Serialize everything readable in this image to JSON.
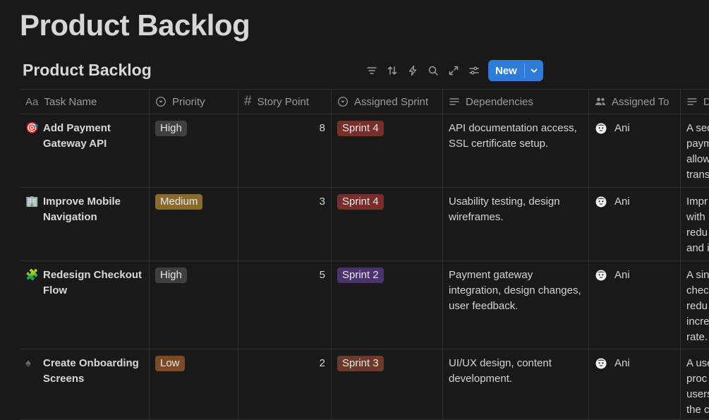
{
  "page": {
    "title": "Product Backlog"
  },
  "database": {
    "title": "Product Backlog"
  },
  "toolbar": {
    "icons": [
      "filter-icon",
      "sort-icon",
      "automation-icon",
      "search-icon",
      "expand-icon",
      "settings-icon"
    ],
    "new_label": "New",
    "accent": "#2f7bd8"
  },
  "columns": [
    {
      "label": "Task Name",
      "icon": "text-aa-icon",
      "glyph": "Aa"
    },
    {
      "label": "Priority",
      "icon": "select-icon"
    },
    {
      "label": "Story Point",
      "icon": "number-icon",
      "glyph": "#"
    },
    {
      "label": "Assigned Sprint",
      "icon": "select-icon"
    },
    {
      "label": "Dependencies",
      "icon": "text-lines-icon"
    },
    {
      "label": "Assigned To",
      "icon": "people-icon"
    },
    {
      "label": "D",
      "icon": "text-lines-icon"
    }
  ],
  "rows": [
    {
      "emoji": "🎯",
      "task": "Add Payment Gateway API",
      "priority": {
        "label": "High",
        "color": "#3f3f3f"
      },
      "points": "8",
      "sprint": {
        "label": "Sprint 4",
        "color": "#7a2e2a"
      },
      "dependencies": "API documentation access, SSL certificate setup.",
      "assignee": "Ani",
      "desc_lines": [
        "A sec",
        "paym",
        "allow",
        "trans"
      ]
    },
    {
      "emoji": "🏢",
      "task": "Improve Mobile Navigation",
      "priority": {
        "label": "Medium",
        "color": "#8a6b2d"
      },
      "points": "3",
      "sprint": {
        "label": "Sprint 4",
        "color": "#7a2e2a"
      },
      "dependencies": "Usability testing, design wireframes.",
      "assignee": "Ani",
      "desc_lines": [
        "Impr",
        "with",
        "redu",
        "and i"
      ]
    },
    {
      "emoji": "🧩",
      "task": "Redesign Checkout Flow",
      "priority": {
        "label": "High",
        "color": "#3f3f3f"
      },
      "points": "5",
      "sprint": {
        "label": "Sprint 2",
        "color": "#4b3371"
      },
      "dependencies": "Payment gateway integration, design changes, user feedback.",
      "assignee": "Ani",
      "desc_lines": [
        "A sin",
        "chec",
        "redu",
        "incre",
        "rate."
      ]
    },
    {
      "emoji": "♠",
      "task": "Create Onboarding Screens",
      "priority": {
        "label": "Low",
        "color": "#7d4a26"
      },
      "points": "2",
      "sprint": {
        "label": "Sprint 3",
        "color": "#6b3a2a"
      },
      "dependencies": "UI/UX design, content development.",
      "assignee": "Ani",
      "desc_lines": [
        "A use",
        "proc",
        "users",
        "the c"
      ]
    }
  ]
}
